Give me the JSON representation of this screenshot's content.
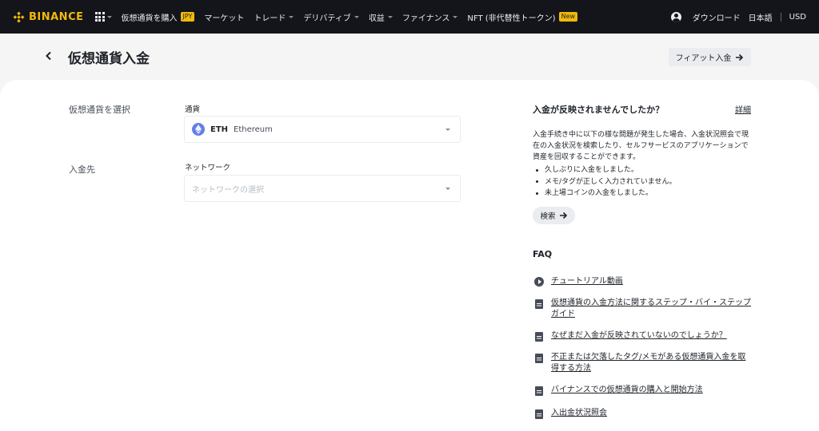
{
  "brand": {
    "name": "BINANCE",
    "color": "#f0b90b"
  },
  "nav": {
    "items": [
      {
        "label": "仮想通貨を購入",
        "badge": "JPY",
        "has_caret": false
      },
      {
        "label": "マーケット",
        "badge": "",
        "has_caret": false
      },
      {
        "label": "トレード",
        "badge": "",
        "has_caret": true
      },
      {
        "label": "デリバティブ",
        "badge": "",
        "has_caret": true
      },
      {
        "label": "収益",
        "badge": "",
        "has_caret": true
      },
      {
        "label": "ファイナンス",
        "badge": "",
        "has_caret": true
      },
      {
        "label": "NFT (非代替性トークン)",
        "badge": "New",
        "has_caret": false
      }
    ],
    "download": "ダウンロード",
    "language": "日本語",
    "currency": "USD"
  },
  "header": {
    "title": "仮想通貨入金",
    "fiat_button": "フィアット入金"
  },
  "form": {
    "select_crypto_label": "仮想通貨を選択",
    "currency_field_label": "通貨",
    "currency_symbol": "ETH",
    "currency_name": "Ethereum",
    "destination_label": "入金先",
    "network_field_label": "ネットワーク",
    "network_placeholder": "ネットワークの選択"
  },
  "help": {
    "title": "入金が反映されませんでしたか？",
    "detail_link": "詳細",
    "description": "入金手続き中に以下の様な問題が発生した場合、入金状況照会で現在の入金状況を検索したり、セルフサービスのアプリケーションで資産を回収することができます。",
    "bullets": [
      "久しぶりに入金をしました。",
      "メモ/タグが正しく入力されていません。",
      "未上場コインの入金をしました。"
    ],
    "search_button": "検索"
  },
  "faq": {
    "title": "FAQ",
    "items": [
      {
        "icon": "play-icon",
        "text": "チュートリアル動画"
      },
      {
        "icon": "document-icon",
        "text": "仮想通貨の入金方法に関するステップ・バイ・ステップガイド"
      },
      {
        "icon": "document-icon",
        "text": "なぜまだ入金が反映されていないのでしょうか？"
      },
      {
        "icon": "document-icon",
        "text": "不正または欠落したタグ/メモがある仮想通貨入金を取得する方法"
      },
      {
        "icon": "document-icon",
        "text": "バイナンスでの仮想通貨の購入と開始方法"
      },
      {
        "icon": "document-icon",
        "text": "入出金状況照会"
      }
    ]
  }
}
